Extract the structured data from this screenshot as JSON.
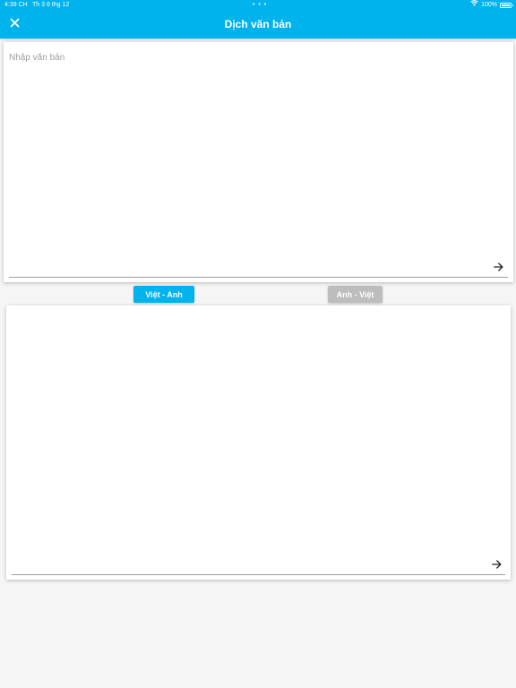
{
  "status_bar": {
    "time": "4:39 CH",
    "date": "Th 3 6 thg 12",
    "dots": "• • •",
    "battery_text": "100%"
  },
  "header": {
    "title": "Dịch văn bản",
    "close_icon": "close-icon"
  },
  "input_card": {
    "placeholder": "Nhập văn bản",
    "value": "",
    "submit_icon": "arrow-right-icon"
  },
  "language_toggle": {
    "vi_en_label": "Việt - Anh",
    "en_vi_label": "Anh - Việt",
    "selected": "Việt - Anh"
  },
  "output_card": {
    "value": "",
    "submit_icon": "arrow-right-icon"
  },
  "colors": {
    "accent": "#00b3ec",
    "inactive_button": "#bdbdbd",
    "background": "#f5f5f5"
  }
}
